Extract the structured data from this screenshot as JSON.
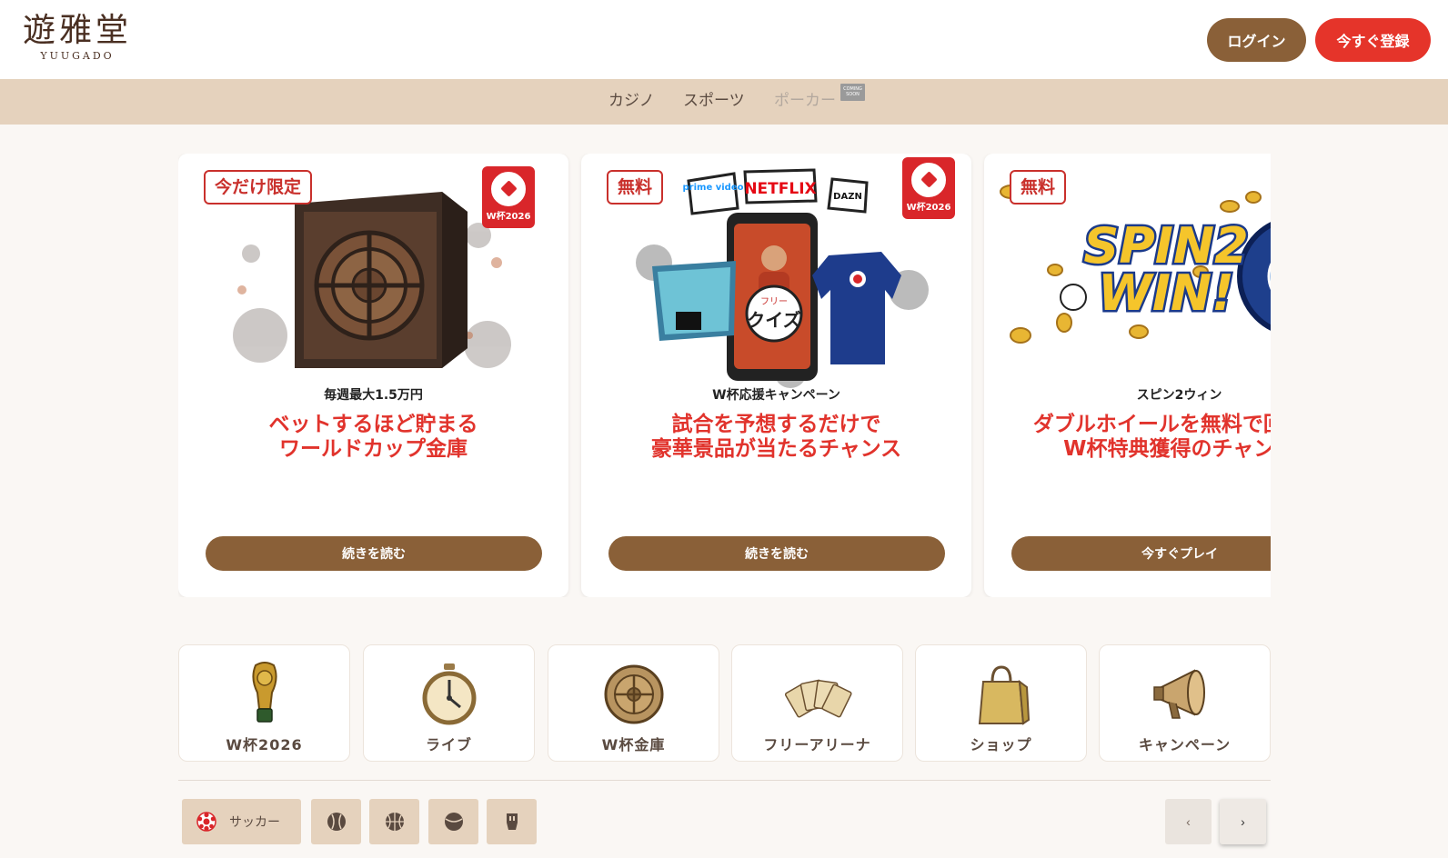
{
  "brand": {
    "name": "遊雅堂",
    "sub": "YUUGADO"
  },
  "header": {
    "login_label": "ログイン",
    "register_label": "今すぐ登録"
  },
  "nav": {
    "items": [
      {
        "label": "カジノ"
      },
      {
        "label": "スポーツ"
      },
      {
        "label": "ポーカー"
      }
    ],
    "soon_badge": "COMING SOON"
  },
  "promos": [
    {
      "tag": "今だけ限定",
      "badge": "W杯2026",
      "subtitle": "毎週最大1.5万円",
      "title": "ベットするほど貯まる\nワールドカップ金庫",
      "button": "続きを読む"
    },
    {
      "tag": "無料",
      "badge": "W杯2026",
      "subtitle": "W杯応援キャンペーン",
      "title": "試合を予想するだけで\n豪華景品が当たるチャンス",
      "button": "続きを読む",
      "art_labels": [
        "prime video",
        "NETFLIX",
        "DAZN",
        "フリー",
        "クイズ"
      ]
    },
    {
      "tag": "無料",
      "subtitle": "スピン2ウィン",
      "title": "ダブルホイールを無料で回して\nW杯特典獲得のチャンス",
      "button": "今すぐプレイ",
      "art_labels": [
        "SPIN2",
        "WIN!"
      ]
    }
  ],
  "quick_links": [
    {
      "label": "W杯2026",
      "icon": "trophy-icon"
    },
    {
      "label": "ライブ",
      "icon": "stopwatch-icon"
    },
    {
      "label": "W杯金庫",
      "icon": "vault-coin-icon"
    },
    {
      "label": "フリーアリーナ",
      "icon": "cards-icon"
    },
    {
      "label": "ショップ",
      "icon": "shopping-bag-icon"
    },
    {
      "label": "キャンペーン",
      "icon": "megaphone-icon"
    }
  ],
  "sports": {
    "active_label": "サッカー",
    "icons": [
      "soccer-icon",
      "baseball-icon",
      "basketball-icon",
      "tennis-icon",
      "esports-icon"
    ]
  },
  "pager": {
    "prev": "‹",
    "next": "›"
  },
  "colors": {
    "brown": "#8a6038",
    "red": "#e5342a",
    "beige": "#e5d2bd",
    "promo_red": "#e1332c"
  }
}
